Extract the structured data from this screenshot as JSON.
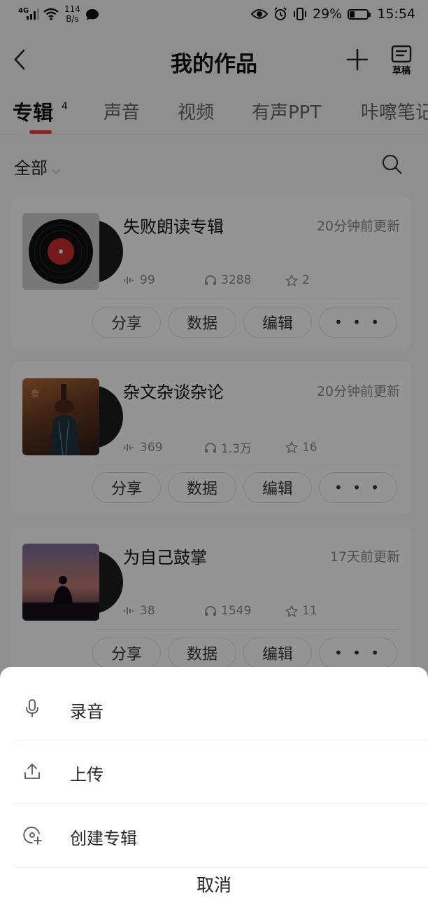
{
  "status_bar": {
    "network": "4G",
    "speed_value": "114",
    "speed_unit": "B/s",
    "battery": "29%",
    "battery_level": 0.29,
    "time": "15:54"
  },
  "header": {
    "title": "我的作品",
    "draft_label": "草稿"
  },
  "tabs": [
    {
      "label": "专辑",
      "count": "4",
      "active": true
    },
    {
      "label": "声音"
    },
    {
      "label": "视频"
    },
    {
      "label": "有声PPT"
    },
    {
      "label": "咔嚓笔记"
    }
  ],
  "filter": {
    "label": "全部"
  },
  "albums": [
    {
      "title": "失败朗读专辑",
      "updated": "20分钟前更新",
      "tracks": "99",
      "plays": "3288",
      "favorites": "2",
      "cover": "vinyl-placeholder"
    },
    {
      "title": "杂文杂谈杂论",
      "updated": "20分钟前更新",
      "tracks": "369",
      "plays": "1.3万",
      "favorites": "16",
      "cover": "mannequin-photo"
    },
    {
      "title": "为自己鼓掌",
      "updated": "17天前更新",
      "tracks": "38",
      "plays": "1549",
      "favorites": "11",
      "cover": "sunset-silhouette-photo"
    }
  ],
  "card_actions": {
    "share": "分享",
    "data": "数据",
    "edit": "编辑",
    "more": "• • •"
  },
  "sheet": {
    "items": [
      {
        "label": "录音",
        "icon": "microphone-icon"
      },
      {
        "label": "上传",
        "icon": "upload-icon"
      },
      {
        "label": "创建专辑",
        "icon": "create-album-icon"
      }
    ],
    "cancel": "取消"
  },
  "colors": {
    "accent": "#e3403c",
    "overlay": "rgba(0,0,0,0.42)"
  }
}
